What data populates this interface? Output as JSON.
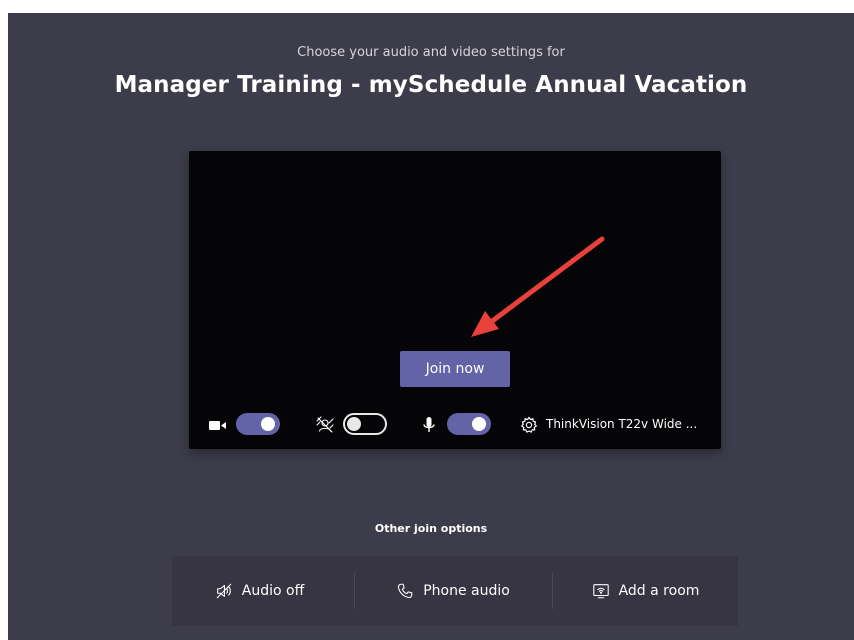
{
  "header": {
    "subtitle": "Choose your audio and video settings for",
    "meeting_title": "Manager Training - mySchedule Annual Vacation"
  },
  "preview": {
    "join_button_label": "Join now",
    "annotation": "arrow-pointing-to-join-button",
    "controls": {
      "camera": {
        "icon": "camera-icon",
        "toggle_state": "on"
      },
      "background_blur": {
        "icon": "background-blur-icon",
        "toggle_state": "off"
      },
      "microphone": {
        "icon": "microphone-icon",
        "toggle_state": "on"
      },
      "device_settings": {
        "icon": "gear-icon",
        "label": "ThinkVision T22v Wide ..."
      }
    }
  },
  "other_options": {
    "heading": "Other join options",
    "items": [
      {
        "icon": "speaker-muted-icon",
        "label": "Audio off"
      },
      {
        "icon": "phone-icon",
        "label": "Phone audio"
      },
      {
        "icon": "cast-screen-icon",
        "label": "Add a room"
      }
    ]
  },
  "colors": {
    "background": "#3d3c4a",
    "preview_background": "#050407",
    "accent": "#6264a7",
    "options_bar": "#363541",
    "annotation_arrow": "#e8403a"
  }
}
